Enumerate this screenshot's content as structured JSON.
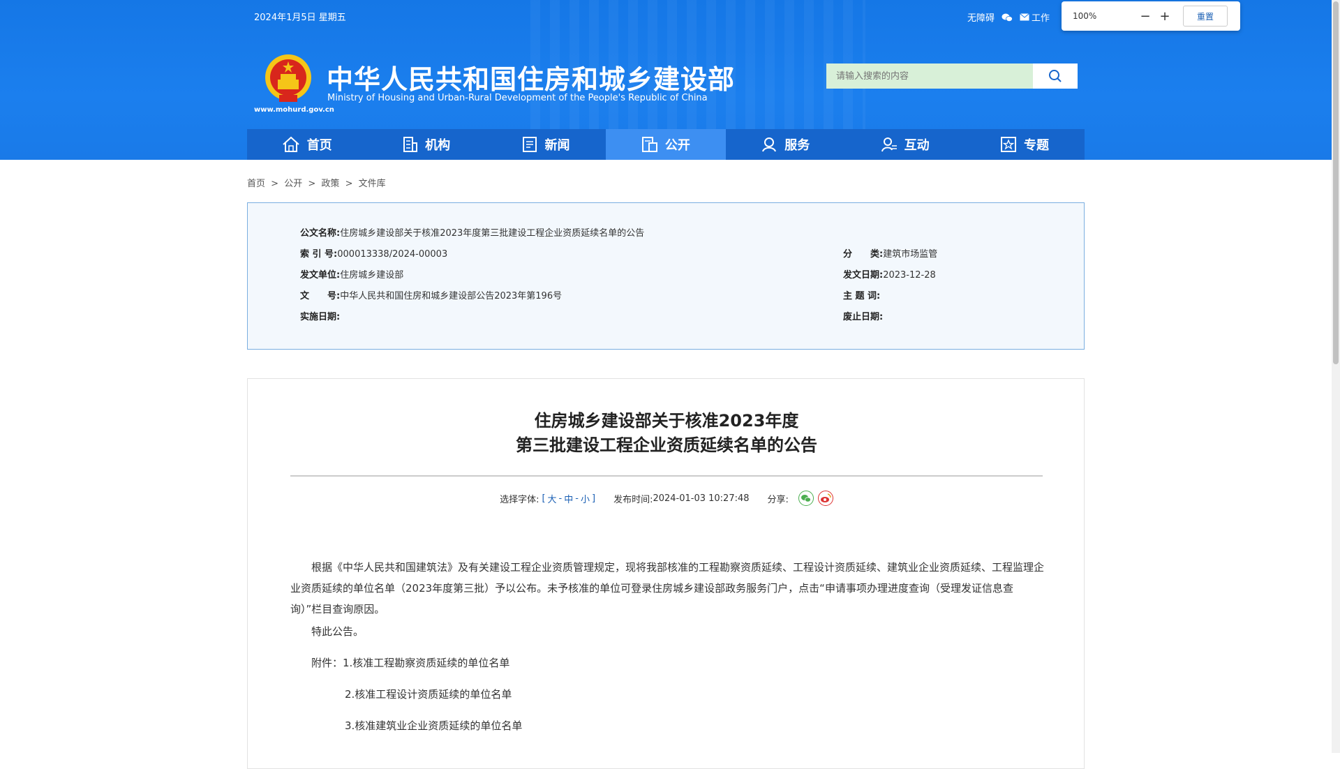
{
  "header": {
    "date": "2024年1月5日 星期五",
    "links": {
      "accessibility": "无障碍",
      "mail": "工作"
    },
    "site_url": "www.mohurd.gov.cn",
    "title": "中华人民共和国住房和城乡建设部",
    "subtitle": "Ministry of Housing and Urban-Rural Development of the People's Republic of China",
    "search_placeholder": "请输入搜索的内容"
  },
  "zoom": {
    "percent": "100%",
    "minus": "−",
    "plus": "+",
    "reset": "重置"
  },
  "nav": [
    {
      "label": "首页",
      "icon": "home-icon"
    },
    {
      "label": "机构",
      "icon": "building-icon"
    },
    {
      "label": "新闻",
      "icon": "news-icon"
    },
    {
      "label": "公开",
      "icon": "disclosure-icon",
      "active": true
    },
    {
      "label": "服务",
      "icon": "service-icon"
    },
    {
      "label": "互动",
      "icon": "interaction-icon"
    },
    {
      "label": "专题",
      "icon": "topic-icon"
    }
  ],
  "breadcrumb": {
    "home": "首页",
    "open": "公开",
    "policy": "政策",
    "library": "文件库",
    "sep": ">"
  },
  "meta": {
    "name_k": "公文名称:",
    "name_v": "住房城乡建设部关于核准2023年度第三批建设工程企业资质延续名单的公告",
    "index_k": "索 引 号:",
    "index_v": "000013338/2024-00003",
    "category_k": "分　　类:",
    "category_v": "建筑市场监管",
    "issuer_k": "发文单位:",
    "issuer_v": "住房城乡建设部",
    "issue_date_k": "发文日期:",
    "issue_date_v": "2023-12-28",
    "doc_no_k": "文　　号:",
    "doc_no_v": "中华人民共和国住房和城乡建设部公告2023年第196号",
    "subject_k": "主 题 词:",
    "subject_v": "",
    "impl_k": "实施日期:",
    "impl_v": "",
    "expire_k": "废止日期:",
    "expire_v": ""
  },
  "article": {
    "title_line1": "住房城乡建设部关于核准2023年度",
    "title_line2": "第三批建设工程企业资质延续名单的公告",
    "font_label": "选择字体:",
    "font_open": "[",
    "font_large": "大",
    "font_dash1": "-",
    "font_medium": "中",
    "font_dash2": "-",
    "font_small": "小",
    "font_close": "]",
    "publish_label": "发布时间:",
    "publish_time": "2024-01-03 10:27:48",
    "share_label": "分享:",
    "para1": "根据《中华人民共和国建筑法》及有关建设工程企业资质管理规定，现将我部核准的工程勘察资质延续、工程设计资质延续、建筑业企业资质延续、工程监理企业资质延续的单位名单（2023年度第三批）予以公布。未予核准的单位可登录住房城乡建设部政务服务门户，点击“申请事项办理进度查询（受理发证信息查询）”栏目查询原因。",
    "para2": "特此公告。",
    "attach1": "附件：1.核准工程勘察资质延续的单位名单",
    "attach2": "2.核准工程设计资质延续的单位名单",
    "attach3": "3.核准建筑业企业资质延续的单位名单"
  },
  "colors": {
    "header": "#1a7ae8",
    "nav": "#1665cc",
    "nav_active": "#3d8ff2",
    "link": "#1a5fb4"
  }
}
